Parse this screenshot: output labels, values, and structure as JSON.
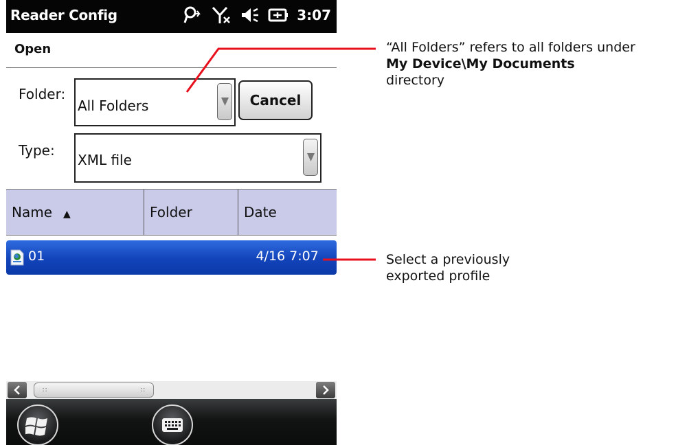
{
  "app": {
    "title": "Reader Config",
    "clock": "3:07"
  },
  "status_icons": [
    "sync-icon",
    "no-signal-icon",
    "speaker-icon",
    "battery-icon"
  ],
  "dialog": {
    "title": "Open",
    "cancel_label": "Cancel"
  },
  "folder": {
    "label": "Folder:",
    "value": "All Folders"
  },
  "type": {
    "label": "Type:",
    "value": "XML file"
  },
  "columns": [
    {
      "label": "Name",
      "sort": "ascending"
    },
    {
      "label": "Folder"
    },
    {
      "label": "Date"
    }
  ],
  "files": [
    {
      "name": "01",
      "date": "4/16 7:07 ..."
    }
  ],
  "taskbar": {
    "icons": [
      "windows-start-icon",
      "keyboard-icon"
    ]
  },
  "callouts": {
    "folder_note": {
      "line1": "“All Folders” refers to all folders under",
      "line2_bold": "My Device\\My Documents",
      "line3": "directory"
    },
    "profile_note": {
      "line1": "Select a previously",
      "line2": "exported profile"
    },
    "line_color": "#e8101c"
  },
  "colors": {
    "titlebar": "#050505",
    "header_row": "#c9cbe9",
    "selection": "#1243b9"
  }
}
